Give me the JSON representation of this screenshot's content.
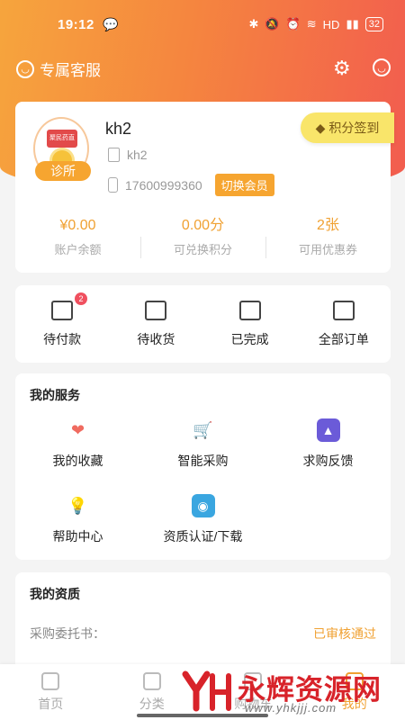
{
  "status_bar": {
    "time": "19:12",
    "network": "HD",
    "battery": "32"
  },
  "top": {
    "service_label": "专属客服"
  },
  "profile": {
    "avatar_plate_text": "聚民药直达",
    "clinic_badge": "诊所",
    "username": "kh2",
    "company": "kh2",
    "phone": "17600999360",
    "switch_label": "切换会员",
    "signin_label": "积分签到",
    "stats": [
      {
        "value": "¥0.00",
        "label": "账户余额"
      },
      {
        "value": "0.00分",
        "label": "可兑换积分"
      },
      {
        "value": "2张",
        "label": "可用优惠券"
      }
    ]
  },
  "orders": [
    {
      "label": "待付款",
      "icon": "wallet-icon",
      "badge": "2"
    },
    {
      "label": "待收货",
      "icon": "truck-icon"
    },
    {
      "label": "已完成",
      "icon": "check-box-icon"
    },
    {
      "label": "全部订单",
      "icon": "clipboard-icon"
    }
  ],
  "services": {
    "title": "我的服务",
    "items": [
      {
        "label": "我的收藏",
        "icon": "heart-icon",
        "color": "#f06b60"
      },
      {
        "label": "智能采购",
        "icon": "cart-icon",
        "color": "#f2744a"
      },
      {
        "label": "求购反馈",
        "icon": "feedback-icon",
        "color": "#6b5bd8"
      },
      {
        "label": "帮助中心",
        "icon": "lightbulb-icon",
        "color": "#f6a530"
      },
      {
        "label": "资质认证/下载",
        "icon": "camera-icon",
        "color": "#3aa6e0"
      }
    ]
  },
  "qualifications": {
    "title": "我的资质",
    "rows": [
      {
        "key": "采购委托书：",
        "status": "已审核通过"
      }
    ]
  },
  "tabbar": [
    {
      "label": "首页",
      "active": false
    },
    {
      "label": "分类",
      "active": false
    },
    {
      "label": "购物车",
      "active": false
    },
    {
      "label": "我的",
      "active": true
    }
  ],
  "watermark": {
    "title": "永辉资源网",
    "url": "www.yhkjjj.com"
  },
  "colors": {
    "accent": "#f0a132",
    "hero_start": "#f6a53d",
    "hero_end": "#f25c4f"
  }
}
